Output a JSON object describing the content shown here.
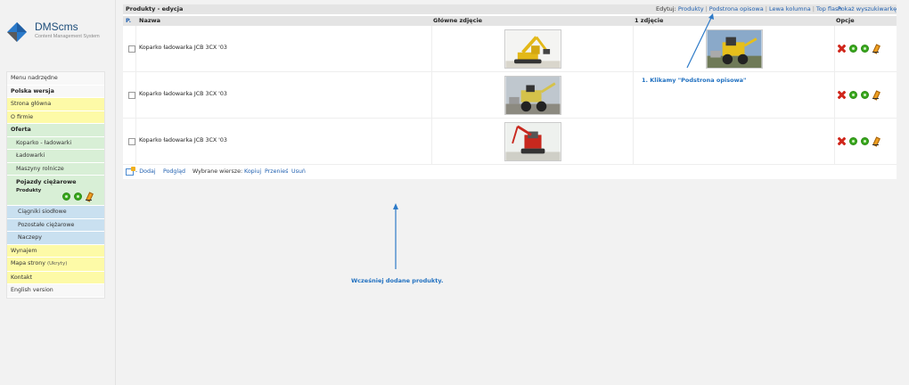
{
  "app": {
    "brand": "DMScms",
    "tagline": "Content Management System"
  },
  "sidebar": {
    "items": [
      {
        "label": "Menu nadrzędne",
        "style": "plain"
      },
      {
        "label": "Polska wersja",
        "style": "bold"
      },
      {
        "label": "Strona główna",
        "style": "yel"
      },
      {
        "label": "O firmie",
        "style": "yel"
      },
      {
        "label": "Oferta",
        "style": "grn-head"
      },
      {
        "label": "Koparko - ładowarki",
        "style": "grn"
      },
      {
        "label": "Ładowarki",
        "style": "grn"
      },
      {
        "label": "Maszyny rolnicze",
        "style": "grn"
      }
    ],
    "selected": {
      "label": "Pojazdy ciężarowe",
      "sub": "Produkty"
    },
    "items_after": [
      {
        "label": "Ciągniki siodłowe",
        "style": "blu"
      },
      {
        "label": "Pozostałe ciężarowe",
        "style": "blu"
      },
      {
        "label": "Naczepy",
        "style": "blu"
      },
      {
        "label": "Wynajem",
        "style": "yel"
      },
      {
        "label": "Mapa strony",
        "note": "(Ukryty)",
        "style": "yel"
      },
      {
        "label": "Kontakt",
        "style": "yel"
      },
      {
        "label": "English version",
        "style": "plain"
      }
    ]
  },
  "main": {
    "title": "Produkty - edycja",
    "edit_label": "Edytuj:",
    "edit_links": [
      "Produkty",
      "Podstrona opisowa",
      "Lewa kolumna",
      "Top flash"
    ],
    "show_search": "Pokaż wyszukiwarkę",
    "columns": {
      "p": "P.",
      "name": "Nazwa",
      "main_image": "Główne zdjęcie",
      "first_image": "1 zdjęcie",
      "options": "Opcje"
    },
    "rows": [
      {
        "name": "Koparko ładowarka JCB 3CX '03"
      },
      {
        "name": "Koparko ładowarka JCB 3CX '03"
      },
      {
        "name": "Koparko ładowarka JCB 3CX '03"
      }
    ],
    "footer": {
      "add": "- Dodaj",
      "preview": "Podgląd",
      "selected_rows": "Wybrane wiersze:",
      "copy": "Kopiuj",
      "move": "Przenieś",
      "delete": "Usuń"
    }
  },
  "annotations": {
    "step1": "1. Klikamy \"Podstrona opisowa\"",
    "earlier": "Wcześniej dodane produkty."
  },
  "colors": {
    "accent": "#2060b0",
    "annotation": "#2070c0",
    "yellow_item": "#fdfaa7",
    "green_item": "#d8efd6",
    "blue_item": "#c9e0f0"
  }
}
